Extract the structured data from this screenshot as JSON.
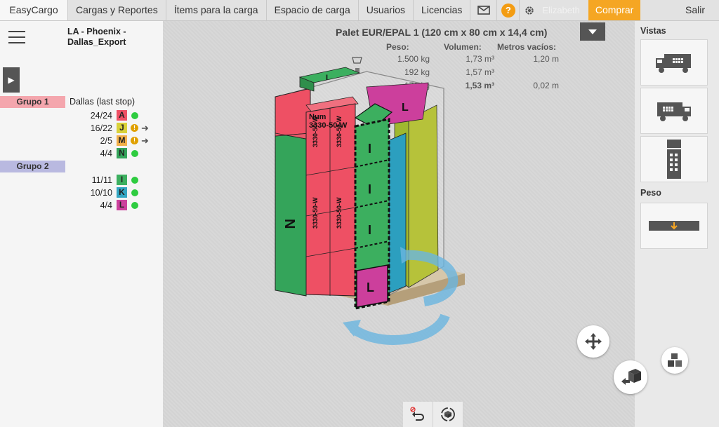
{
  "nav": {
    "brand": "EasyCargo",
    "tabs": [
      "Cargas y Reportes",
      "Ítems para la carga",
      "Espacio de carga",
      "Usuarios",
      "Licencias"
    ],
    "help": "?",
    "user": "Elizabeth",
    "buy": "Comprar",
    "logout": "Salir"
  },
  "left": {
    "load_title": "LA - Phoenix - Dallas_Export",
    "groups": [
      {
        "label": "Grupo 1",
        "color": "#f4a6ad",
        "stop": "Dallas (last stop)",
        "items": [
          {
            "count": "24/24",
            "code": "A",
            "color": "#ee5064",
            "status": "ok"
          },
          {
            "count": "16/22",
            "code": "J",
            "color": "#d9d23a",
            "status": "warn"
          },
          {
            "count": "2/5",
            "code": "M",
            "color": "#f2b04a",
            "status": "warn"
          },
          {
            "count": "4/4",
            "code": "N",
            "color": "#34a45a",
            "status": "ok"
          }
        ]
      },
      {
        "label": "Grupo 2",
        "color": "#b9b9e0",
        "stop": "",
        "items": [
          {
            "count": "11/11",
            "code": "I",
            "color": "#3caf5f",
            "status": "ok"
          },
          {
            "count": "10/10",
            "code": "K",
            "color": "#33a6c2",
            "status": "ok"
          },
          {
            "count": "4/4",
            "code": "L",
            "color": "#cc3f9c",
            "status": "ok"
          }
        ]
      }
    ]
  },
  "viewport": {
    "pallet_title": "Palet EUR/EPAL 1 (120 cm x 80 cm x 14,4 cm)",
    "stats_headers": [
      "Peso:",
      "Volumen:",
      "Metros vacíos:"
    ],
    "stats_rows": [
      [
        "1.500 kg",
        "1,73 m³",
        "1,20 m"
      ],
      [
        "192 kg",
        "1,57 m³",
        ""
      ],
      [
        "171 kg",
        "1,53 m³",
        "0,02 m"
      ]
    ],
    "box_label_num": "Num",
    "box_label_code": "3330-50-W",
    "box_letters": [
      "N",
      "I",
      "L",
      "I"
    ]
  },
  "right": {
    "views_label": "Vistas",
    "weight_label": "Peso"
  }
}
